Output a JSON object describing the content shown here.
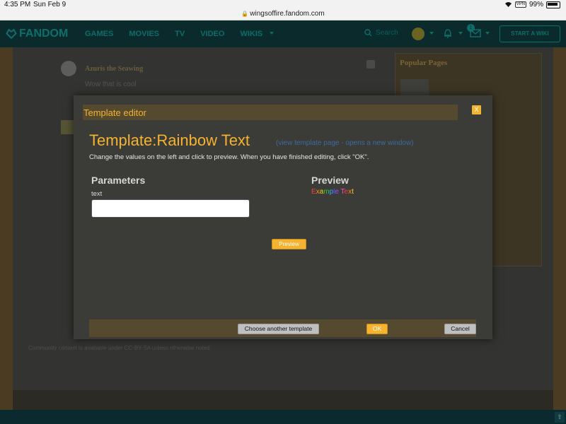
{
  "status_bar": {
    "time": "4:35 PM",
    "date": "Sun Feb 9",
    "vpn": "VPN",
    "battery": "99%"
  },
  "url_bar": {
    "url": "wingsoffire.fandom.com"
  },
  "nav": {
    "logo": "FANDOM",
    "links": [
      "GAMES",
      "MOVIES",
      "TV",
      "VIDEO",
      "WIKIS"
    ],
    "search_label": "Search",
    "notification_count": "1",
    "start_wiki": "START A WIKI"
  },
  "comment": {
    "author": "Azuris the Seawing",
    "text": "Wow that is cool"
  },
  "sidebar": {
    "title": "Popular Pages"
  },
  "footer": {
    "license_note": "Community content is available under CC-BY-SA unless otherwise noted."
  },
  "modal": {
    "title": "Template editor",
    "close_label": "X",
    "template_name": "Template:Rainbow Text",
    "template_link": "(view template page - opens a new window)",
    "instructions": "Change the values on the left and click to preview. When you have finished editing, click \"OK\".",
    "parameters_heading": "Parameters",
    "param_label": "text",
    "param_value": "",
    "preview_heading": "Preview",
    "preview_text": "Example Text",
    "preview_button": "Preview",
    "choose_button": "Choose another template",
    "ok_button": "OK",
    "cancel_button": "Cancel"
  },
  "colors": {
    "accent": "#f5b32f",
    "link": "#3f6aa0",
    "nav_teal": "#0c6d6a"
  }
}
